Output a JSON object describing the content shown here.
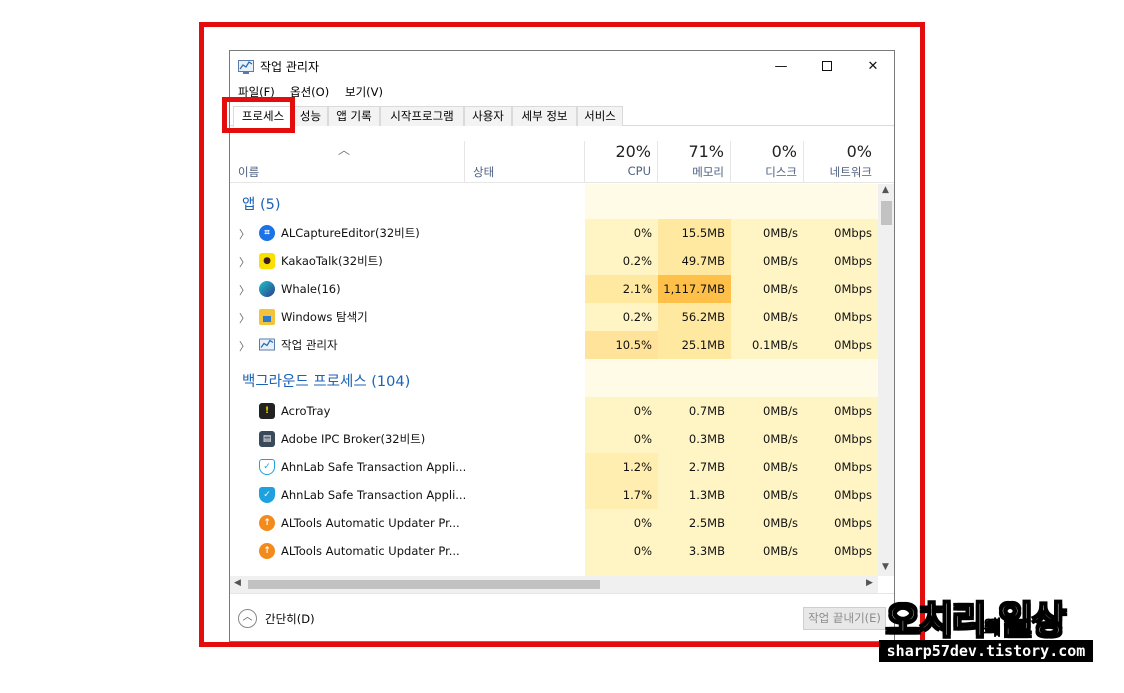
{
  "window": {
    "title": "작업 관리자"
  },
  "menu": [
    "파일(F)",
    "옵션(O)",
    "보기(V)"
  ],
  "tabs": [
    "프로세스",
    "성능",
    "앱 기록",
    "시작프로그램",
    "사용자",
    "세부 정보",
    "서비스"
  ],
  "header": {
    "name_label": "이름",
    "status_label": "상태",
    "cpu": {
      "pct": "20%",
      "label": "CPU"
    },
    "memory": {
      "pct": "71%",
      "label": "메모리"
    },
    "disk": {
      "pct": "0%",
      "label": "디스크"
    },
    "network": {
      "pct": "0%",
      "label": "네트워크"
    }
  },
  "groups": {
    "apps": {
      "title": "앱 (5)"
    },
    "background": {
      "title": "백그라운드 프로세스 (104)"
    }
  },
  "apps": [
    {
      "name": "ALCaptureEditor(32비트)",
      "icon": "alcapture-icon",
      "cpu": "0%",
      "mem": "15.5MB",
      "disk": "0MB/s",
      "net": "0Mbps"
    },
    {
      "name": "KakaoTalk(32비트)",
      "icon": "kakaotalk-icon",
      "cpu": "0.2%",
      "mem": "49.7MB",
      "disk": "0MB/s",
      "net": "0Mbps"
    },
    {
      "name": "Whale(16)",
      "icon": "whale-icon",
      "cpu": "2.1%",
      "mem": "1,117.7MB",
      "disk": "0MB/s",
      "net": "0Mbps"
    },
    {
      "name": "Windows 탐색기",
      "icon": "explorer-icon",
      "cpu": "0.2%",
      "mem": "56.2MB",
      "disk": "0MB/s",
      "net": "0Mbps"
    },
    {
      "name": "작업 관리자",
      "icon": "task-manager-icon",
      "cpu": "10.5%",
      "mem": "25.1MB",
      "disk": "0.1MB/s",
      "net": "0Mbps"
    }
  ],
  "background": [
    {
      "name": "AcroTray",
      "icon": "acrotray-icon",
      "cpu": "0%",
      "mem": "0.7MB",
      "disk": "0MB/s",
      "net": "0Mbps"
    },
    {
      "name": "Adobe IPC Broker(32비트)",
      "icon": "adobe-ipc-icon",
      "cpu": "0%",
      "mem": "0.3MB",
      "disk": "0MB/s",
      "net": "0Mbps"
    },
    {
      "name": "AhnLab Safe Transaction Appli...",
      "icon": "ahnlab-shield-icon",
      "cpu": "1.2%",
      "mem": "2.7MB",
      "disk": "0MB/s",
      "net": "0Mbps"
    },
    {
      "name": "AhnLab Safe Transaction Appli...",
      "icon": "ahnlab-shield-icon",
      "cpu": "1.7%",
      "mem": "1.3MB",
      "disk": "0MB/s",
      "net": "0Mbps"
    },
    {
      "name": "ALTools Automatic Updater Pr...",
      "icon": "altools-updater-icon",
      "cpu": "0%",
      "mem": "2.5MB",
      "disk": "0MB/s",
      "net": "0Mbps"
    },
    {
      "name": "ALTools Automatic Updater Pr...",
      "icon": "altools-updater-icon",
      "cpu": "0%",
      "mem": "3.3MB",
      "disk": "0MB/s",
      "net": "0Mbps"
    }
  ],
  "footer": {
    "fewer_details": "간단히(D)",
    "end_task": "작업 끝내기(E)"
  },
  "watermark": {
    "title_main": "오치리",
    "title_small": "의",
    "title_end": "일상",
    "url": "sharp57dev.tistory.com"
  },
  "colors": {
    "highlight_red": "#e40d0d",
    "heat_light": "#fff4c4",
    "heat_mid": "#ffe9a0",
    "heat_high": "#ffc04a",
    "group_blue": "#1c63b7"
  }
}
